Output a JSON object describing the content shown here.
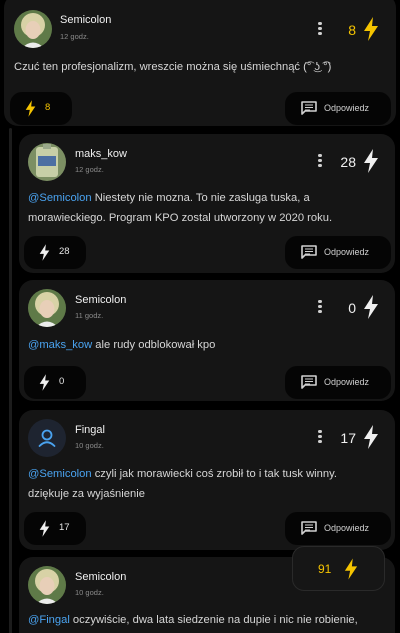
{
  "colors": {
    "accent": "#f5c400",
    "mention": "#4aa3f0",
    "card_bg": "#151515",
    "page_bg": "#000000"
  },
  "main_comment": {
    "username": "Semicolon",
    "time": "12 godz.",
    "count": "8",
    "text": "Czuć ten profesjonalizm, wreszcie można się uśmiechnąć (͡° ͜ʖ ͡°)",
    "vote_count": "8",
    "reply_label": "Odpowiedz"
  },
  "replies": [
    {
      "username": "maks_kow",
      "time": "12 godz.",
      "count": "28",
      "mention": "@Semicolon",
      "text_line1": " Niestety nie mozna. To nie zasluga tuska, a",
      "text_line2": "morawieckiego. Program KPO zostal utworzony w 2020 roku.",
      "vote_count": "28",
      "reply_label": "Odpowiedz"
    },
    {
      "username": "Semicolon",
      "time": "11 godz.",
      "count": "0",
      "mention": "@maks_kow",
      "text_line1": " ale rudy odblokował kpo",
      "vote_count": "0",
      "reply_label": "Odpowiedz"
    },
    {
      "username": "Fingal",
      "time": "10 godz.",
      "count": "17",
      "mention": "@Semicolon",
      "text_line1": " czyli jak morawiecki coś zrobił to i tak tusk winny.",
      "text_line2": "dziękuje za wyjaśnienie",
      "vote_count": "17",
      "reply_label": "Odpowiedz"
    },
    {
      "username": "Semicolon",
      "time": "10 godz.",
      "mention": "@Fingal",
      "text_line1": " oczywiście, dwa lata siedzenie na dupie i nic nie robienie,"
    }
  ],
  "floating_vote": {
    "count": "91"
  },
  "icons": {
    "vote": "lightning-bolt-icon",
    "menu": "kebab-menu-icon",
    "reply": "comment-icon",
    "default_avatar": "user-icon"
  }
}
